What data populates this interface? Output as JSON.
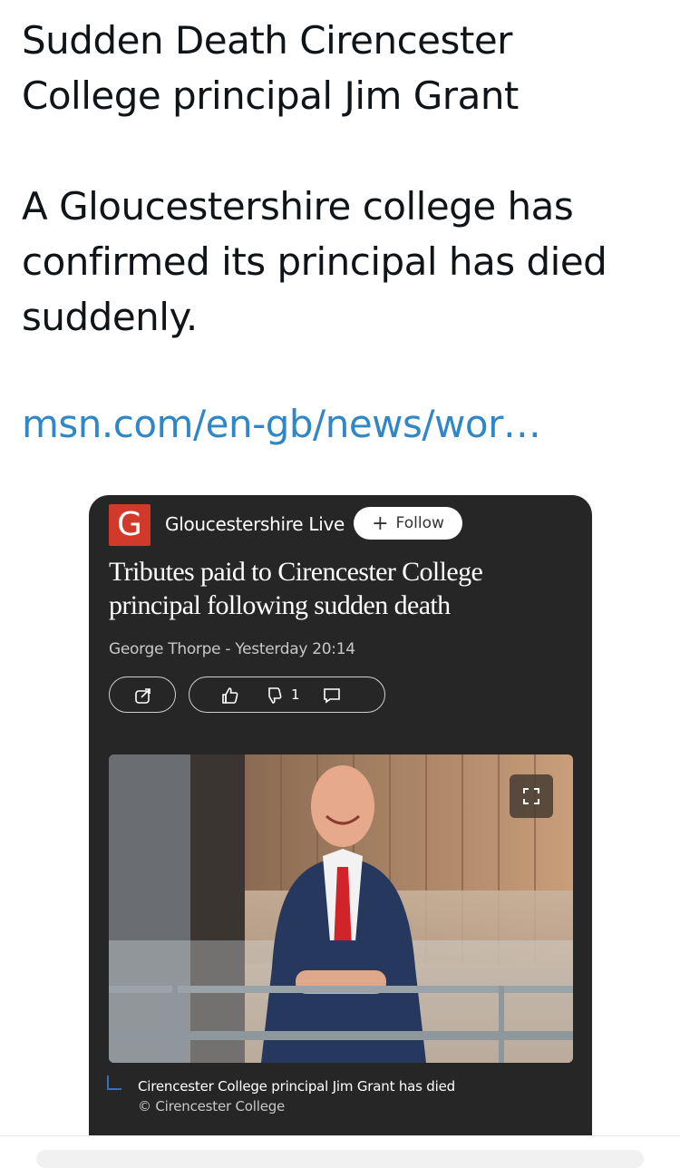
{
  "tweet": {
    "line1": "Sudden Death Cirencester",
    "line2": "College principal Jim Grant",
    "body1": "A Gloucestershire college has",
    "body2": "confirmed its principal has died",
    "body3": "suddenly.",
    "link": "msn.com/en-gb/news/wor…"
  },
  "card": {
    "publisher_logo": "G",
    "publisher_name": "Gloucestershire Live",
    "follow_label": "Follow",
    "headline_line1": "Tributes paid to Cirencester College",
    "headline_line2": "principal following sudden death",
    "byline": "George Thorpe - Yesterday 20:14",
    "dislike_count": "1",
    "caption": "Cirencester College principal Jim Grant has died",
    "credit": "© Cirencester College",
    "icons": [
      "share-icon",
      "thumbs-up-icon",
      "thumbs-down-icon",
      "comment-icon",
      "expand-icon"
    ],
    "colors": {
      "card_bg": "#262626",
      "logo_bg": "#d13a2a",
      "link": "#2f87c8"
    }
  }
}
